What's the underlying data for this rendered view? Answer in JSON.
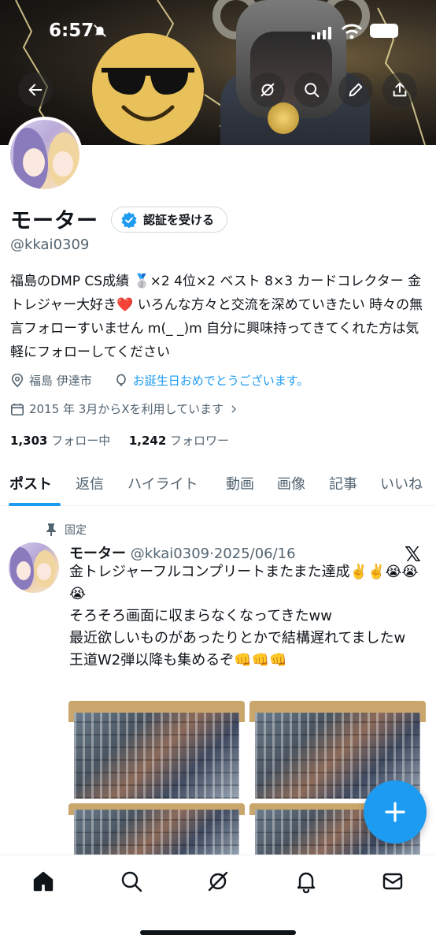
{
  "status_bar": {
    "time": "6:57"
  },
  "profile": {
    "name": "モーター",
    "verify_label": "認証を受ける",
    "handle": "@kkai0309",
    "bio": "福島のDMP CS成績 🥈×2 4位×2 ベスト 8×3 カードコレクター 金トレジャー大好き❤️ いろんな方々と交流を深めていきたい 時々の無言フォローすいません m(_ _)m 自分に興味持ってきてくれた方は気軽にフォローしてください",
    "location": "福島 伊達市",
    "birthday": "お誕生日おめでとうございます。",
    "joined": "2015 年 3月からXを利用しています",
    "following_count": "1,303",
    "following_label": "フォロー中",
    "followers_count": "1,242",
    "followers_label": "フォロワー"
  },
  "tabs": [
    {
      "label": "ポスト",
      "active": true
    },
    {
      "label": "返信"
    },
    {
      "label": "ハイライト"
    },
    {
      "label": "動画"
    },
    {
      "label": "画像"
    },
    {
      "label": "記事"
    },
    {
      "label": "いいね"
    }
  ],
  "pinned_post": {
    "pinned_label": "固定",
    "author_name": "モーター",
    "author_handle": "@kkai0309",
    "separator": "·",
    "date": "2025/06/16",
    "text": "金トレジャーフルコンプリートまたまた達成✌️✌️😭😭😭\nそろそろ画面に収まらなくなってきたww\n最近欲しいものがあったりとかで結構遅れてましたw\n王道W2弾以降も集めるぞ👊👊👊"
  },
  "icons": {
    "banner_buttons": [
      "back-arrow-icon",
      "grok-icon",
      "search-icon",
      "edit-pencil-icon",
      "share-icon"
    ],
    "bottom_nav": [
      "home-icon",
      "search-icon",
      "grok-icon",
      "notifications-bell-icon",
      "messages-envelope-icon"
    ],
    "fab": "plus-icon"
  },
  "colors": {
    "accent": "#1d9bf0",
    "text": "#0f1419",
    "secondary": "#536471"
  }
}
